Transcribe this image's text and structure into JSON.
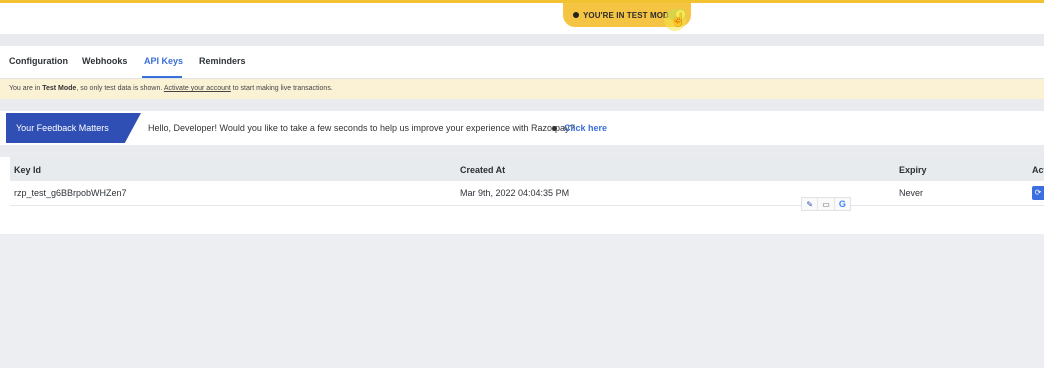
{
  "header": {
    "test_mode_label": "YOU'RE IN TEST MODE"
  },
  "tabs": [
    {
      "label": "Configuration",
      "active": false
    },
    {
      "label": "Webhooks",
      "active": false
    },
    {
      "label": "API Keys",
      "active": true
    },
    {
      "label": "Reminders",
      "active": false
    }
  ],
  "notice": {
    "prefix": "You are in ",
    "mode": "Test Mode",
    "middle": ", so only test data is shown. ",
    "link": "Activate your account",
    "suffix": " to start making live transactions."
  },
  "feedback": {
    "badge": "Your Feedback Matters",
    "message": "Hello, Developer! Would you like to take a few seconds to help us improve your experience with Razorpay?",
    "cta": "Click here"
  },
  "table": {
    "columns": [
      "Key Id",
      "Created At",
      "Expiry",
      "Act"
    ],
    "rows": [
      {
        "key_id": "rzp_test_g6BBrpobWHZen7",
        "created_at": "Mar 9th, 2022 04:04:35 PM",
        "expiry": "Never"
      }
    ]
  },
  "colors": {
    "accent": "#3a6fd8",
    "test_banner": "#f6c443",
    "feedback_badge": "#2f4fb4",
    "notice_bg": "#fbf2d6"
  },
  "icons": {
    "toggle": "toggle-switch-icon",
    "cursor": "hand-pointer-icon",
    "action": "regenerate-icon",
    "ext_pen": "pencil-icon",
    "ext_chat": "comment-icon",
    "ext_google": "google-icon"
  }
}
